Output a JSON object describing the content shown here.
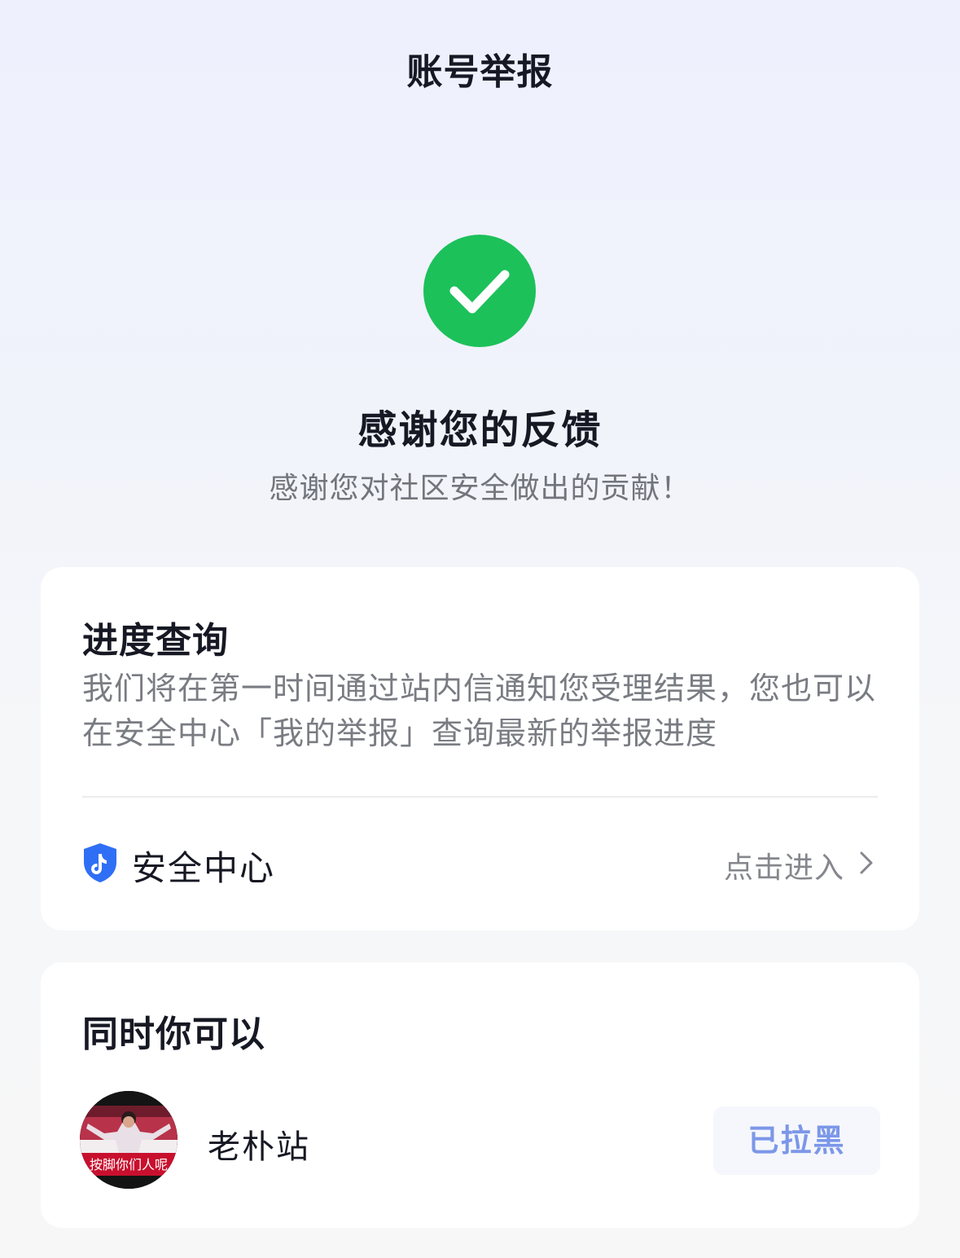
{
  "header": {
    "title": "账号举报"
  },
  "result": {
    "icon": "check-circle-icon",
    "status_color": "#1cc15a",
    "title": "感谢您的反馈",
    "subtitle": "感谢您对社区安全做出的贡献！"
  },
  "progress": {
    "title": "进度查询",
    "description": "我们将在第一时间通过站内信通知您受理结果，您也可以在安全中心「我的举报」查询最新的举报进度",
    "security_center": {
      "icon": "shield-icon",
      "label": "安全中心",
      "action_label": "点击进入",
      "action_icon": "chevron-right-icon"
    }
  },
  "also": {
    "title": "同时你可以",
    "user": {
      "name": "老朴站",
      "avatar_caption": "按脚你们人呢",
      "button_label": "已拉黑"
    }
  },
  "colors": {
    "accent": "#7c97e8",
    "shield": "#2f6ff5"
  }
}
